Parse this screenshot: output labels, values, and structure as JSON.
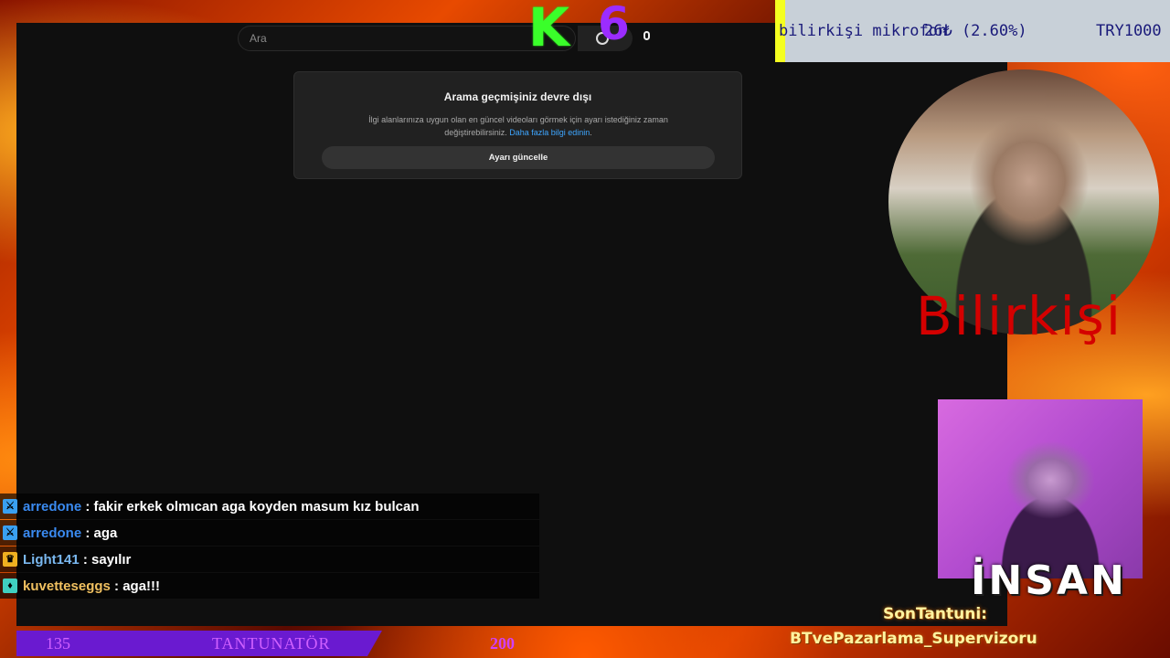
{
  "overlay": {
    "logo_k": "K",
    "logo_6": "6"
  },
  "youtube": {
    "search_placeholder": "Ara",
    "search_icon": "search-icon",
    "mic_icon": "mic-icon",
    "dialog": {
      "title": "Arama geçmişiniz devre dışı",
      "desc": "İlgi alanlarınıza uygun olan en güncel videoları görmek için ayarı istediğiniz zaman değiştirebilirsiniz.",
      "link": "Daha fazla bilgi edinin",
      "link_suffix": ".",
      "button": "Ayarı güncelle"
    }
  },
  "ticker": {
    "name": "bilirkişi mikrofon",
    "price": "26₺ (2.60%)",
    "total": "TRY1000",
    "bar_color": "#f5ff20"
  },
  "webcams": {
    "cam1_label": "Bilirkişi",
    "cam2_label": "İNSAN"
  },
  "last_tantuni": {
    "label": "SonTantuni:",
    "name": "BTvePazarlama_Supervizoru"
  },
  "chat": [
    {
      "user": "arredone",
      "message": " : fakir erkek olmıcan aga koyden masum kız bulcan",
      "user_color": "#3a8af0",
      "badge": "sword-icon",
      "badge_color": "#3aa0f0"
    },
    {
      "user": "arredone",
      "message": " : aga",
      "user_color": "#3a8af0",
      "badge": "sword-icon",
      "badge_color": "#3aa0f0"
    },
    {
      "user": "Light141",
      "message": " : sayılır",
      "user_color": "#7ab8f0",
      "badge": "crown-icon",
      "badge_color": "#f0b020"
    },
    {
      "user": "kuvetteseggs",
      "message": " : aga!!!",
      "user_color": "#f0c060",
      "badge": "prime-icon",
      "badge_color": "#40d0c0"
    }
  ],
  "bottom": {
    "left_value": "135",
    "label": "TANTUNATÖR",
    "right_value": "200"
  }
}
